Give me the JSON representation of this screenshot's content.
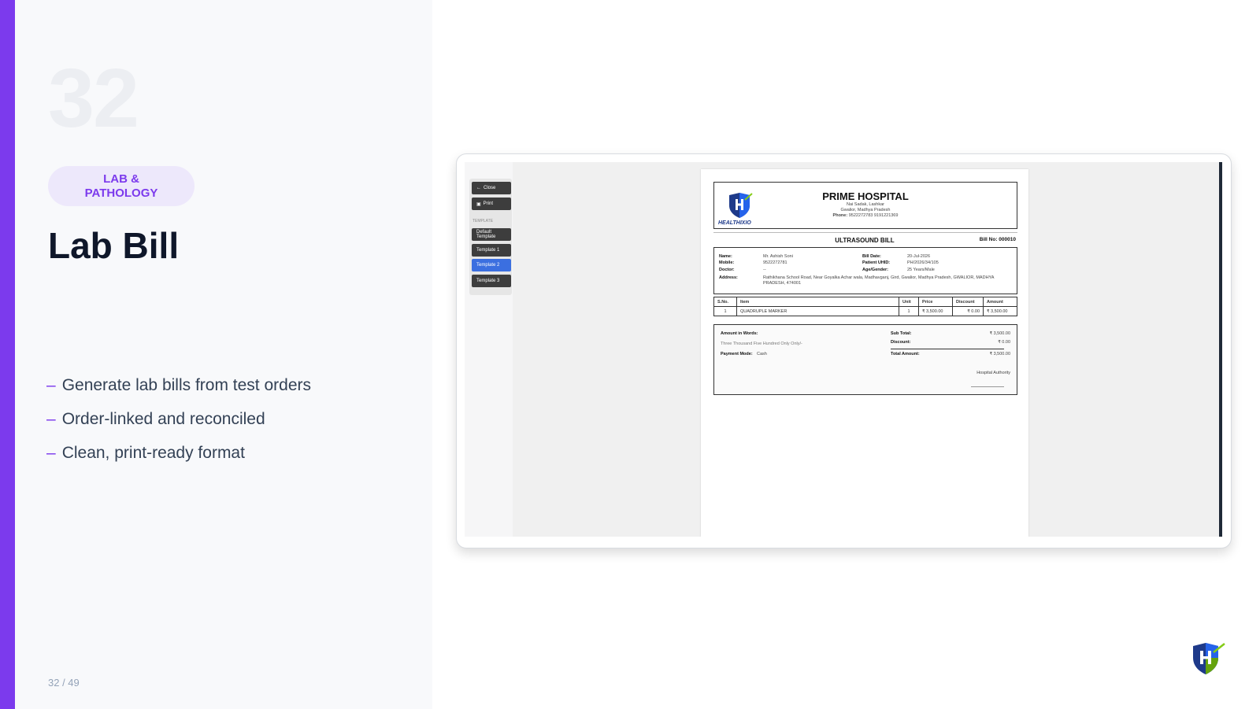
{
  "slide": {
    "number": "32",
    "category": "LAB & PATHOLOGY",
    "title": "Lab Bill",
    "bullets": [
      "Generate lab bills from test orders",
      "Order-linked and reconciled",
      "Clean, print-ready format"
    ],
    "page_count": "32 / 49",
    "bullet_marker": "–"
  },
  "colors": {
    "accent": "#7c3aed",
    "badge_bg": "#ede8fb",
    "active_template": "#3b6fe0"
  },
  "app": {
    "side_menu": {
      "close_label": "Close",
      "print_label": "Print",
      "template_header": "TEMPLATE",
      "templates": [
        "Default Template",
        "Template 1",
        "Template 2",
        "Template 3"
      ],
      "active_template": "Template 2"
    },
    "bill": {
      "logo_text": "HEALTHIXIO",
      "hospital_name": "PRIME HOSPITAL",
      "address_line1": "Nai Sadak, Lashkar",
      "address_line2": "Gwalior, Madhya Pradesh",
      "phone_label": "Phone:",
      "phone": "9522272783 9191221369",
      "title": "ULTRASOUND BILL",
      "bill_no": "Bill No: 000010",
      "patient": {
        "name_label": "Name:",
        "name": "Mr. Ashish Soni",
        "mobile_label": "Mobile:",
        "mobile": "9522272781",
        "doctor_label": "Doctor:",
        "doctor": "--",
        "address_label": "Address:",
        "address": "Rathikhana School Road, Near Goyalka Achar wala, Madhavganj, Gird, Gwalior, Madhya Pradesh, GWALIOR, MADHYA PRADESH, 474001",
        "bill_date_label": "Bill Date:",
        "bill_date": "20-Jul-2026",
        "uhid_label": "Patient UHID:",
        "uhid": "PH/2026/34/105",
        "age_label": "Age/Gender:",
        "age_gender": "25 Years/Male"
      },
      "table": {
        "headers": [
          "S.No.",
          "Item",
          "Unit",
          "Price",
          "Discount",
          "Amount"
        ],
        "rows": [
          [
            "1",
            "QUADRUPLE MARKER",
            "1",
            "₹ 3,500.00",
            "₹ 0.00",
            "₹ 3,500.00"
          ]
        ]
      },
      "summary": {
        "words_label": "Amount in Words:",
        "words": "Three Thousand Five Hundred Only Only/-",
        "payment_label": "Payment Mode:",
        "payment": "Cash",
        "subtotal_label": "Sub Total:",
        "subtotal": "₹ 3,500.00",
        "discount_label": "Discount:",
        "discount": "₹ 0.00",
        "total_label": "Total Amount:",
        "total": "₹ 3,500.00",
        "authority": "Hospital Authority"
      }
    }
  }
}
